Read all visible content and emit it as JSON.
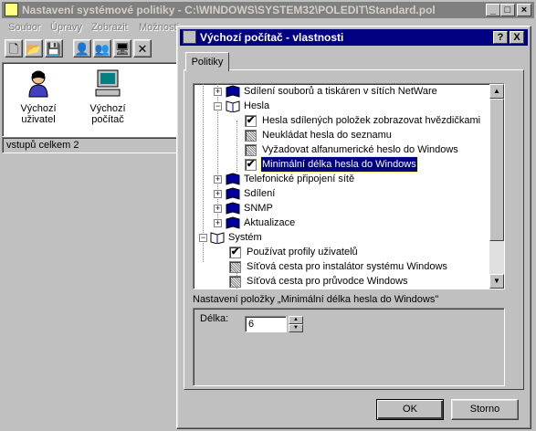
{
  "main_window": {
    "title": "Nastavení systémové politiky - C:\\WINDOWS\\SYSTEM32\\POLEDIT\\Standard.pol",
    "menu": [
      "Soubor",
      "Úpravy",
      "Zobrazit",
      "Možnosti"
    ],
    "icons": [
      {
        "label_line1": "Výchozí",
        "label_line2": "uživatel"
      },
      {
        "label_line1": "Výchozí",
        "label_line2": "počítač"
      }
    ],
    "status": "vstupů celkem 2"
  },
  "dialog": {
    "title": "Výchozí počítač - vlastnosti",
    "tab": "Politiky",
    "tree": [
      {
        "label": "Sdílení souborů a tiskáren v sítích NetWare",
        "kind": "book",
        "expander": "+"
      },
      {
        "label": "Hesla",
        "kind": "openbook",
        "expander": "−"
      },
      {
        "label": "Hesla sdílených položek zobrazovat hvězdičkami",
        "kind": "check",
        "state": "✔"
      },
      {
        "label": "Neukládat hesla do seznamu",
        "kind": "check",
        "state": "gray"
      },
      {
        "label": "Vyžadovat alfanumerické heslo do Windows",
        "kind": "check",
        "state": "gray"
      },
      {
        "label": "Minimální délka hesla do Windows",
        "kind": "check",
        "state": "✔",
        "selected": true
      },
      {
        "label": "Telefonické připojení sítě",
        "kind": "book",
        "expander": "+"
      },
      {
        "label": "Sdílení",
        "kind": "book",
        "expander": "+"
      },
      {
        "label": "SNMP",
        "kind": "book",
        "expander": "+"
      },
      {
        "label": "Aktualizace",
        "kind": "book",
        "expander": "+"
      },
      {
        "label": "Systém",
        "kind": "openbook",
        "expander": "−"
      },
      {
        "label": "Používat profily uživatelů",
        "kind": "check",
        "state": "✔"
      },
      {
        "label": "Síťová cesta pro instalátor systému Windows",
        "kind": "check",
        "state": "gray"
      },
      {
        "label": "Síťová cesta pro průvodce Windows",
        "kind": "check",
        "state": "gray"
      }
    ],
    "settings_label": "Nastavení položky „Minimální délka hesla do Windows\"",
    "length_label": "Délka:",
    "length_value": "6",
    "ok": "OK",
    "cancel": "Storno",
    "help_btn": "?",
    "close_btn": "X"
  }
}
